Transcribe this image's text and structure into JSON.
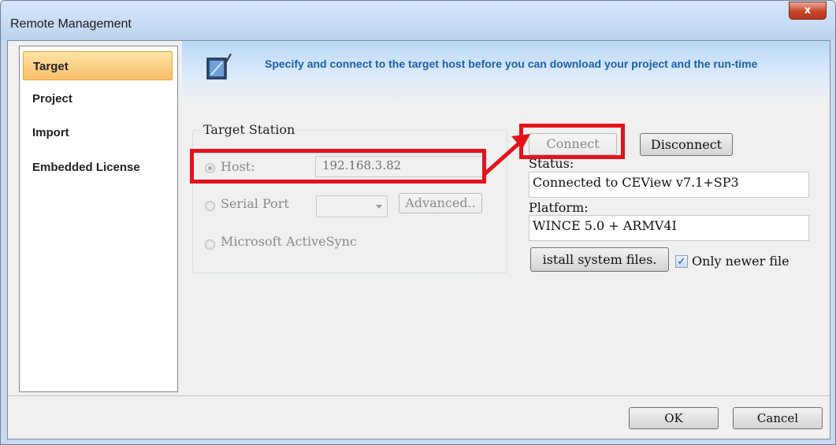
{
  "window": {
    "title": "Remote Management",
    "close_glyph": "x"
  },
  "sidebar": {
    "items": [
      {
        "label": "Target",
        "selected": true
      },
      {
        "label": "Project",
        "selected": false
      },
      {
        "label": "Import",
        "selected": false
      },
      {
        "label": "Embedded License",
        "selected": false
      }
    ]
  },
  "banner": {
    "icon": "monitor-pen-icon",
    "text": "Specify and connect to the target host before you can download your project and the run-time"
  },
  "target_station": {
    "legend": "Target Station",
    "host": {
      "label": "Host:",
      "value": "192.168.3.82",
      "selected": true
    },
    "serial": {
      "label": "Serial Port",
      "combo_value": "",
      "advanced_label": "Advanced.."
    },
    "activesync": {
      "label": "Microsoft ActiveSync"
    }
  },
  "connection": {
    "connect_label": "Connect",
    "disconnect_label": "Disconnect",
    "status_label": "Status:",
    "status_value": "Connected to CEView v7.1+SP3",
    "platform_label": "Platform:",
    "platform_value": "WINCE 5.0 + ARMV4I",
    "install_label": "istall system files.",
    "only_newer_label": "Only newer file",
    "only_newer_checked": true
  },
  "footer": {
    "ok_label": "OK",
    "cancel_label": "Cancel"
  },
  "annotation": {
    "color": "#e4131b"
  }
}
